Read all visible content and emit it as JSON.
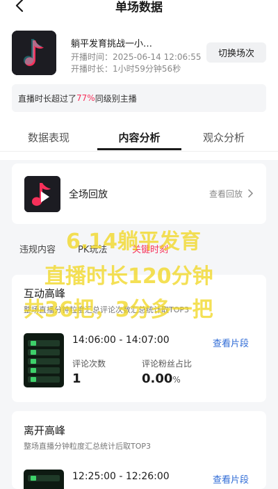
{
  "header": {
    "title": "单场数据",
    "back_icon": "chevron-left-icon"
  },
  "session": {
    "name": "躺平发育挑战一小…",
    "start_time_label": "开播时间：",
    "start_time": "2025-06-14 12:06:55",
    "duration_label": "开播时长：",
    "duration": "1小时59分钟56秒",
    "switch_label": "切换场次",
    "cover_icon": "music-note-icon"
  },
  "rank": {
    "prefix": "直播时长超过了",
    "percent": "77%",
    "suffix": "同级别主播",
    "accent_color": "#f6305a"
  },
  "tabs": [
    {
      "label": "数据表现",
      "active": false
    },
    {
      "label": "内容分析",
      "active": true
    },
    {
      "label": "观众分析",
      "active": false
    }
  ],
  "replay": {
    "label": "全场回放",
    "link": "查看回放",
    "icon": "play-icon"
  },
  "sub_tabs": [
    {
      "label": "违规内容"
    },
    {
      "label": "PK玩法"
    },
    {
      "label": "关键时刻"
    }
  ],
  "overlay": {
    "line1": "6.14躺平发育",
    "line2": "直播时长120分钟",
    "line3": "共36把，3分多一把"
  },
  "sections": [
    {
      "title": "互动高峰",
      "subtitle": "整场直播分钟粒度汇总评论次数汇总统计取TOP3",
      "time_range": "14:06:00 - 14:07:00",
      "link": "查看片段",
      "stat1_label": "评论次数",
      "stat1_value": "1",
      "stat2_label": "评论粉丝占比",
      "stat2_value": "0.00",
      "stat2_unit": "%"
    },
    {
      "title": "离开高峰",
      "subtitle": "整场直播分钟粒度汇总统计后取TOP3",
      "time_range": "12:25:00 - 12:26:00",
      "link": "查看片段"
    }
  ],
  "colors": {
    "link": "#2f6bd6",
    "accent": "#f6305a",
    "overlay": "#f0d61c"
  }
}
